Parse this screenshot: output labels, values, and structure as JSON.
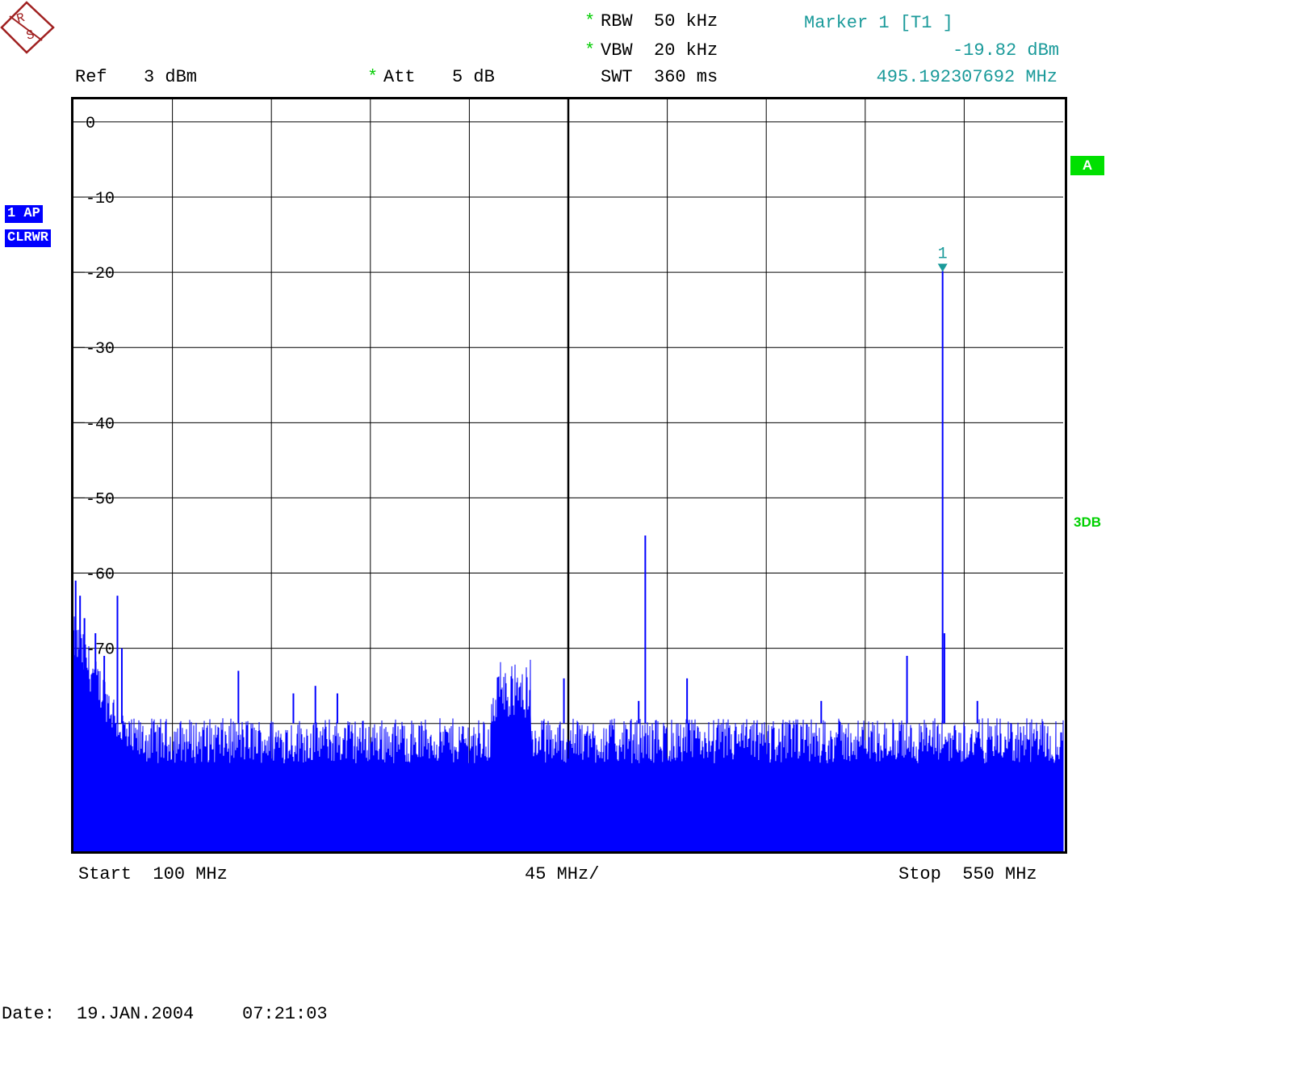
{
  "header": {
    "rbw_label": "RBW",
    "rbw_value": "50 kHz",
    "vbw_label": "VBW",
    "vbw_value": "20 kHz",
    "swt_label": "SWT",
    "swt_value": "360 ms",
    "ref_label": "Ref",
    "ref_value": "3 dBm",
    "att_label": "Att",
    "att_value": "5 dB",
    "star": "*",
    "marker_title": "Marker 1 [T1 ]",
    "marker_level": "-19.82 dBm",
    "marker_freq": "495.192307692 MHz"
  },
  "side": {
    "trace_badge": "1 AP",
    "mode_badge": "CLRWR",
    "trace_label": "A",
    "threshold_label": "3DB"
  },
  "footer": {
    "start": "Start  100 MHz",
    "span": "45 MHz/",
    "stop": "Stop  550 MHz",
    "date_label": "Date:",
    "date": "19.JAN.2004",
    "time": "07:21:03"
  },
  "colors": {
    "trace": "#0000ff",
    "marker": "#1a9a9a",
    "status": "#00dd00",
    "grid": "#000000"
  },
  "chart_data": {
    "type": "line",
    "x_unit": "MHz",
    "y_unit": "dBm",
    "xlim": [
      100,
      550
    ],
    "ylim": [
      -97,
      3
    ],
    "y_ticks": [
      0,
      -10,
      -20,
      -30,
      -40,
      -50,
      -60,
      -70
    ],
    "grid": true,
    "noise_floor": -82,
    "peaks": [
      {
        "x": 101,
        "y": -61
      },
      {
        "x": 103,
        "y": -63
      },
      {
        "x": 105,
        "y": -66
      },
      {
        "x": 110,
        "y": -68
      },
      {
        "x": 114,
        "y": -71
      },
      {
        "x": 120,
        "y": -63
      },
      {
        "x": 122,
        "y": -70
      },
      {
        "x": 175,
        "y": -73
      },
      {
        "x": 200,
        "y": -76
      },
      {
        "x": 210,
        "y": -75
      },
      {
        "x": 220,
        "y": -76
      },
      {
        "x": 323,
        "y": -74
      },
      {
        "x": 360,
        "y": -55
      },
      {
        "x": 357,
        "y": -77
      },
      {
        "x": 379,
        "y": -74
      },
      {
        "x": 440,
        "y": -77
      },
      {
        "x": 479,
        "y": -71
      },
      {
        "x": 495.19,
        "y": -19.82
      },
      {
        "x": 496,
        "y": -68
      },
      {
        "x": 511,
        "y": -77
      }
    ],
    "bump": {
      "x_from": 290,
      "x_to": 308,
      "y": -74
    },
    "marker": {
      "label": "1",
      "x": 495.19,
      "y": -19.82
    }
  }
}
